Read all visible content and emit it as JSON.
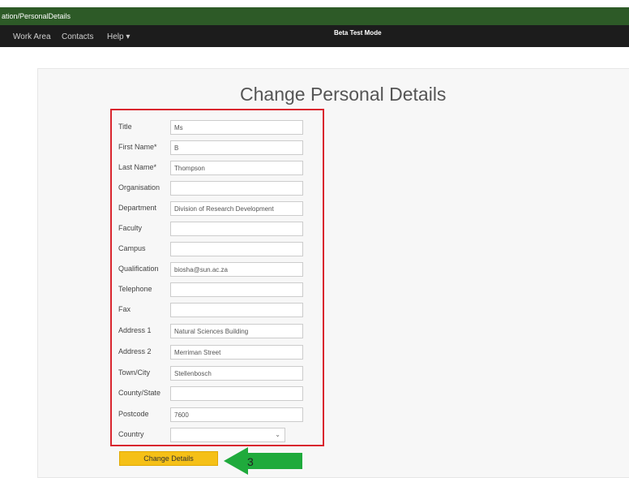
{
  "url_text": "ation/PersonalDetails",
  "nav": {
    "items": [
      "Work Area",
      "Contacts",
      "Help ▾"
    ],
    "beta": "Beta Test Mode"
  },
  "page_title": "Change Personal Details",
  "fields": [
    {
      "label": "Title",
      "value": "Ms"
    },
    {
      "label": "First Name*",
      "value": "B"
    },
    {
      "label": "Last Name*",
      "value": "Thompson"
    },
    {
      "label": "Organisation",
      "value": ""
    },
    {
      "label": "Department",
      "value": "Division of Research Development"
    },
    {
      "label": "Faculty",
      "value": ""
    },
    {
      "label": "Campus",
      "value": ""
    },
    {
      "label": "Qualification",
      "value": "biosha@sun.ac.za"
    },
    {
      "label": "Telephone",
      "value": ""
    },
    {
      "label": "Fax",
      "value": ""
    },
    {
      "label": "Address 1",
      "value": "Natural Sciences Building"
    },
    {
      "label": "Address 2",
      "value": "Merriman Street"
    },
    {
      "label": "Town/City",
      "value": "Stellenbosch"
    },
    {
      "label": "County/State",
      "value": ""
    },
    {
      "label": "Postcode",
      "value": "7600"
    }
  ],
  "country": {
    "label": "Country",
    "value": ""
  },
  "change_button": "Change Details",
  "annotation": {
    "number": "3",
    "arrow_color": "#1faa3c",
    "box_color": "#d9262e"
  }
}
